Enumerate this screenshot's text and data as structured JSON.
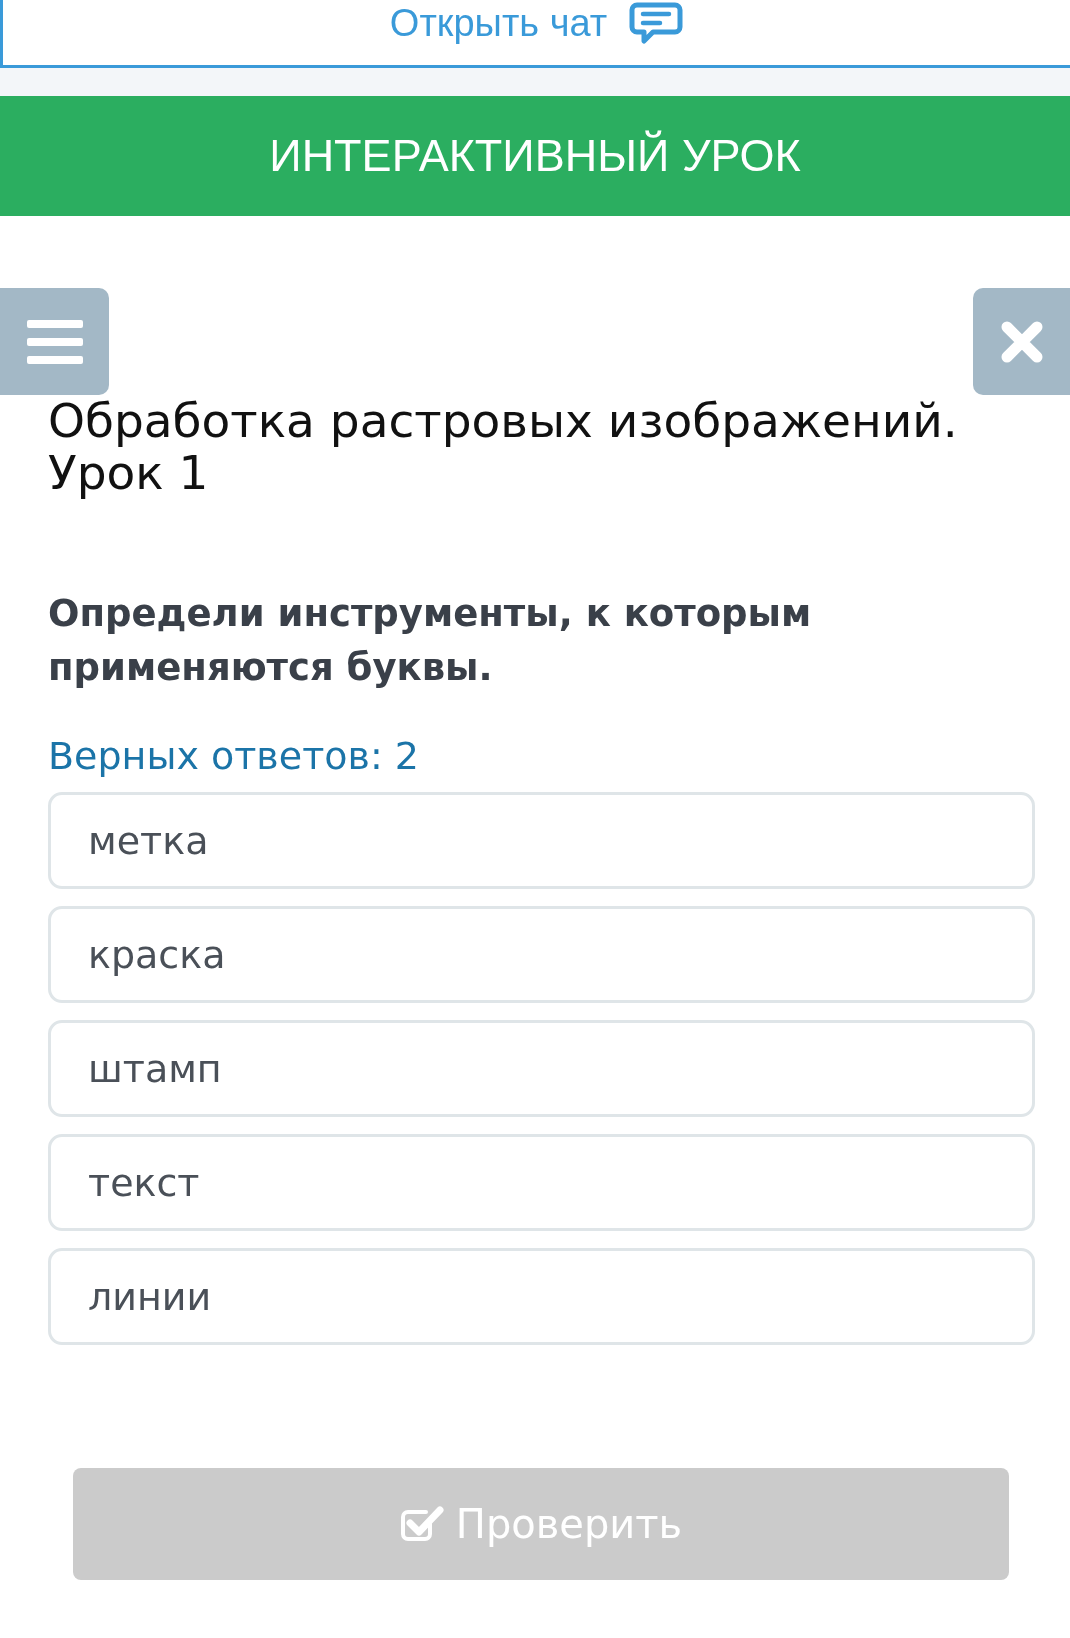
{
  "chat_link": {
    "label": "Открыть чат"
  },
  "banner": {
    "title": "ИНТЕРАКТИВНЫЙ УРОК"
  },
  "lesson": {
    "title": "Обработка растровых изображений. Урок 1"
  },
  "question": {
    "prompt": "Определи инструменты, к которым применяются буквы.",
    "answers_note": "Верных ответов: 2"
  },
  "options": [
    {
      "label": "метка",
      "selected": false
    },
    {
      "label": "краска",
      "selected": false
    },
    {
      "label": "штамп",
      "selected": false
    },
    {
      "label": "текст",
      "selected": false
    },
    {
      "label": "линии",
      "selected": false
    }
  ],
  "check_button": {
    "label": "Проверить",
    "disabled": true
  }
}
